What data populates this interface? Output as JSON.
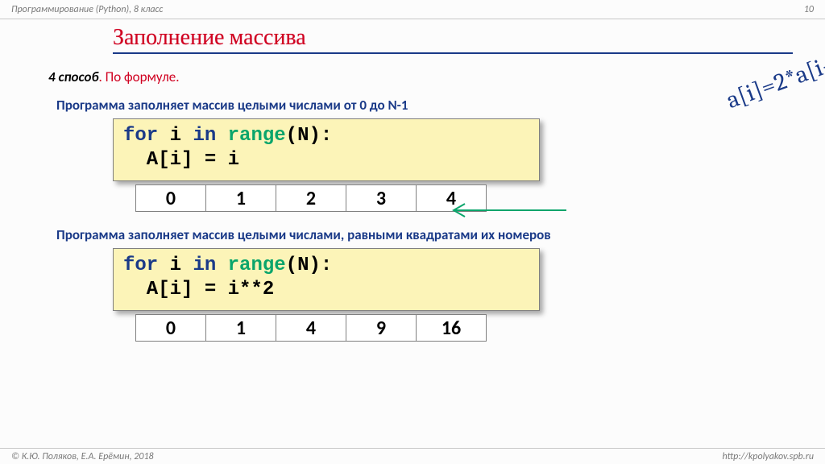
{
  "header": {
    "course": "Программирование (Python), 8 класс",
    "page": "10"
  },
  "footer": {
    "left": "© К.Ю. Поляков, Е.А. Ерёмин, 2018",
    "right": "http://kpolyakov.spb.ru"
  },
  "title": "Заполнение массива",
  "method": {
    "label": "4 способ",
    "text": ". По формуле."
  },
  "formula": "a[i]=2*a[i-",
  "block1": {
    "desc": "Программа заполняет массив целыми числами от 0 до N-1",
    "code": {
      "kw_for": "for",
      "var_i": "i",
      "kw_in": "in",
      "kw_range": "range",
      "arg": "(N):",
      "line2_indent": "  A[i] = i"
    },
    "array": [
      "0",
      "1",
      "2",
      "3",
      "4"
    ]
  },
  "block2": {
    "desc": "Программа заполняет массив целыми числами, равными квадратами их номеров",
    "code": {
      "kw_for": "for",
      "var_i": "i",
      "kw_in": "in",
      "kw_range": "range",
      "arg": "(N):",
      "line2_indent": "  A[i] = i**2"
    },
    "array": [
      "0",
      "1",
      "4",
      "9",
      "16"
    ]
  }
}
